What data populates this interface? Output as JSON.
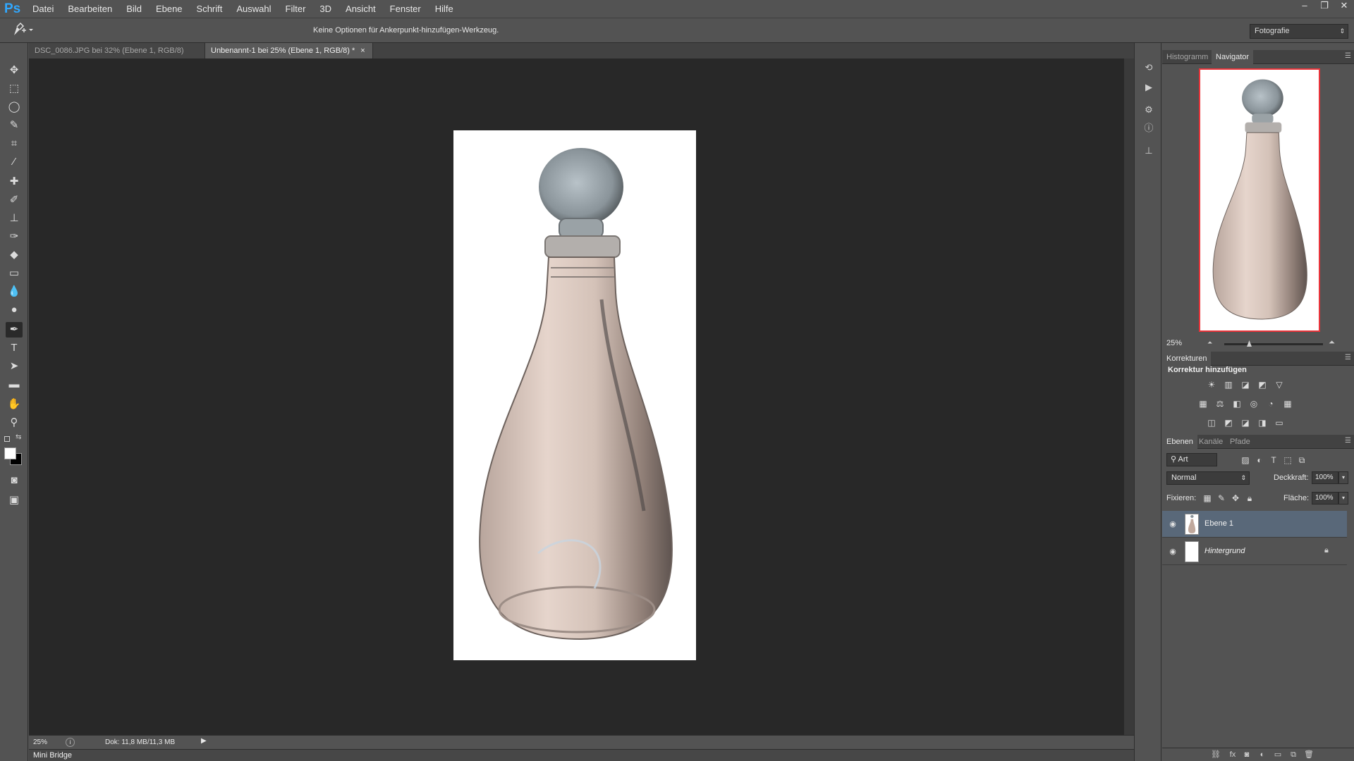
{
  "app": {
    "logo": "Ps",
    "menu": [
      "Datei",
      "Bearbeiten",
      "Bild",
      "Ebene",
      "Schrift",
      "Auswahl",
      "Filter",
      "3D",
      "Ansicht",
      "Fenster",
      "Hilfe"
    ],
    "window_controls": [
      "–",
      "❐",
      "✕"
    ]
  },
  "options": {
    "tool_icon": "pen-tool-icon",
    "hint": "Keine Optionen für Ankerpunkt-hinzufügen-Werkzeug.",
    "workspace": "Fotografie"
  },
  "tabs": [
    {
      "label": "DSC_0086.JPG bei 32% (Ebene 1, RGB/8) *",
      "close": "×",
      "active": false
    },
    {
      "label": "Unbenannt-1 bei 25% (Ebene 1, RGB/8) *",
      "close": "×",
      "active": true
    }
  ],
  "status": {
    "zoom": "25%",
    "doc": "Dok: 11,8 MB/11,3 MB",
    "info_icon": "i",
    "play_icon": "▶"
  },
  "minibridge": {
    "label": "Mini Bridge"
  },
  "navigator": {
    "tabs": [
      "Histogramm",
      "Navigator"
    ],
    "active_tab": "Navigator",
    "zoom": "25%",
    "slider_value": 0.25,
    "view_box_color": "#e8343a"
  },
  "corrections": {
    "tab": "Korrekturen",
    "title": "Korrektur hinzufügen",
    "row1": [
      "☀",
      "▥",
      "◪",
      "◩",
      "▽"
    ],
    "row2": [
      "▦",
      "⚖",
      "◧",
      "◎",
      "◔",
      "▦"
    ],
    "row3": [
      "◫",
      "◩",
      "◪",
      "◨",
      "▭"
    ]
  },
  "layers": {
    "tabs": [
      "Ebenen",
      "Kanäle",
      "Pfade"
    ],
    "active_tab": "Ebenen",
    "filter": "Art",
    "blend_mode": "Normal",
    "opacity_label": "Deckkraft:",
    "opacity": "100%",
    "lock_label": "Fixieren:",
    "fill_label": "Fläche:",
    "fill": "100%",
    "items": [
      {
        "name": "Ebene 1",
        "selected": true,
        "italic": false,
        "locked": false
      },
      {
        "name": "Hintergrund",
        "selected": false,
        "italic": true,
        "locked": true
      }
    ]
  }
}
